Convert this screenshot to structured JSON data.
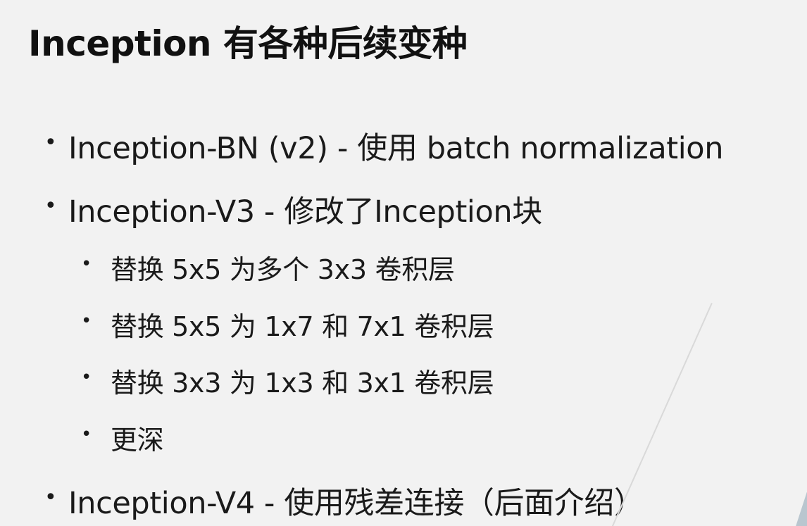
{
  "slide": {
    "title": "Inception 有各种后续变种",
    "bullet_char": "•",
    "items": [
      {
        "level": 1,
        "text": "Inception-BN (v2) - 使用 batch normalization"
      },
      {
        "level": 1,
        "text": "Inception-V3 -  修改了Inception块"
      },
      {
        "level": 2,
        "text": "替换 5x5 为多个 3x3 卷积层"
      },
      {
        "level": 2,
        "text": "替换 5x5 为 1x7 和 7x1 卷积层"
      },
      {
        "level": 2,
        "text": "替换 3x3 为 1x3 和 3x1 卷积层"
      },
      {
        "level": 2,
        "text": "更深"
      },
      {
        "level": 1,
        "text": "Inception-V4 - 使用残差连接（后面介绍）"
      }
    ]
  }
}
